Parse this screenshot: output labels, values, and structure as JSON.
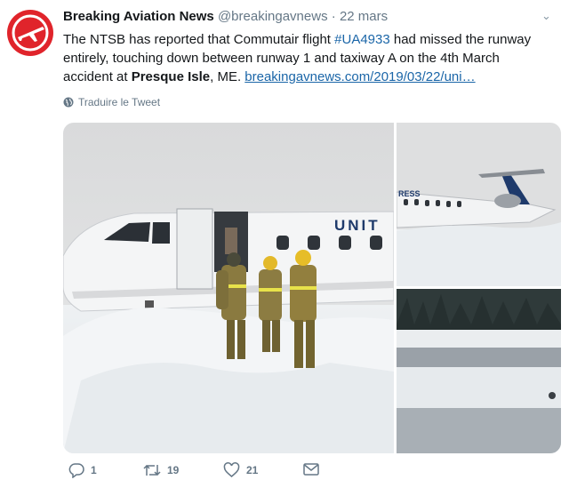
{
  "tweet": {
    "name": "Breaking Aviation News",
    "handle": "@breakingavnews",
    "separator": "·",
    "date": "22 mars",
    "text": {
      "l1_pre": "The NTSB has reported that Commutair flight ",
      "hashtag": "#UA4933",
      "l1_post": " had missed the runway",
      "l2": "entirely, touching down between runway 1 and taxiway A on the 4th March",
      "l3_pre": "accident at ",
      "place": "Presque Isle",
      "l3_mid": ", ME. ",
      "url": "breakingavnews.com/2019/03/22/uni…"
    },
    "translate_label": "Traduire le Tweet",
    "photo_text": {
      "livery_main": "UNIT",
      "livery_tail": "RESS"
    }
  },
  "actions": {
    "reply_count": "1",
    "retweet_count": "19",
    "like_count": "21"
  },
  "colors": {
    "avatar_red": "#e0242b",
    "link_blue": "#1b66a8",
    "muted": "#657786"
  }
}
